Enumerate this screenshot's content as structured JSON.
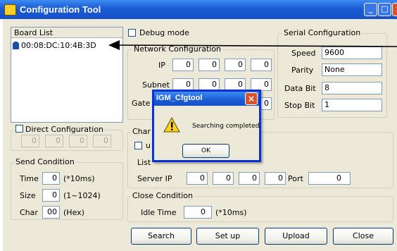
{
  "window": {
    "title": "Configuration Tool"
  },
  "board_list": {
    "label": "Board List",
    "items": [
      "00:08:DC:10:4B:3D"
    ]
  },
  "debug_mode": {
    "label": "Debug mode"
  },
  "network": {
    "title": "Network Configuration",
    "ip_label": "IP",
    "ip": [
      "0",
      "0",
      "0",
      "0"
    ],
    "subnet_label": "Subnet",
    "subnet": [
      "0",
      "0",
      "0",
      "0"
    ],
    "gateway_label": "Gate",
    "gateway": [
      "0"
    ]
  },
  "serial": {
    "title": "Serial Configuration",
    "speed_label": "Speed",
    "speed": "9600",
    "parity_label": "Parity",
    "parity": "None",
    "databit_label": "Data Bit",
    "databit": "8",
    "stopbit_label": "Stop Bit",
    "stopbit": "1"
  },
  "direct": {
    "label": "Direct Configuration",
    "fields": [
      "0",
      "0",
      "0",
      "0"
    ]
  },
  "channel": {
    "title_fragment": "Char",
    "checkbox_fragment": "u",
    "listen_fragment": "List",
    "server_ip_label": "Server IP",
    "server_ip": [
      "0",
      "0",
      "0",
      "0"
    ],
    "port_label": "Port",
    "port": "0"
  },
  "send_condition": {
    "title": "Send Condition",
    "time_label": "Time",
    "time": "0",
    "time_unit": "(*10ms)",
    "size_label": "Size",
    "size": "0",
    "size_unit": "(1~1024)",
    "char_label": "Char",
    "char": "00",
    "char_unit": "(Hex)"
  },
  "close_condition": {
    "title": "Close Condition",
    "idle_label": "Idle Time",
    "idle": "0",
    "idle_unit": "(*10ms)"
  },
  "buttons": {
    "search": "Search",
    "setup": "Set up",
    "upload": "Upload",
    "close": "Close"
  },
  "dialog": {
    "title": "IGM_Cfgtool",
    "message": "Searching completed.",
    "ok": "OK"
  },
  "colors": {
    "titlebar": "#1a5bd4",
    "face": "#ece9d8",
    "arrow": "#000000"
  }
}
